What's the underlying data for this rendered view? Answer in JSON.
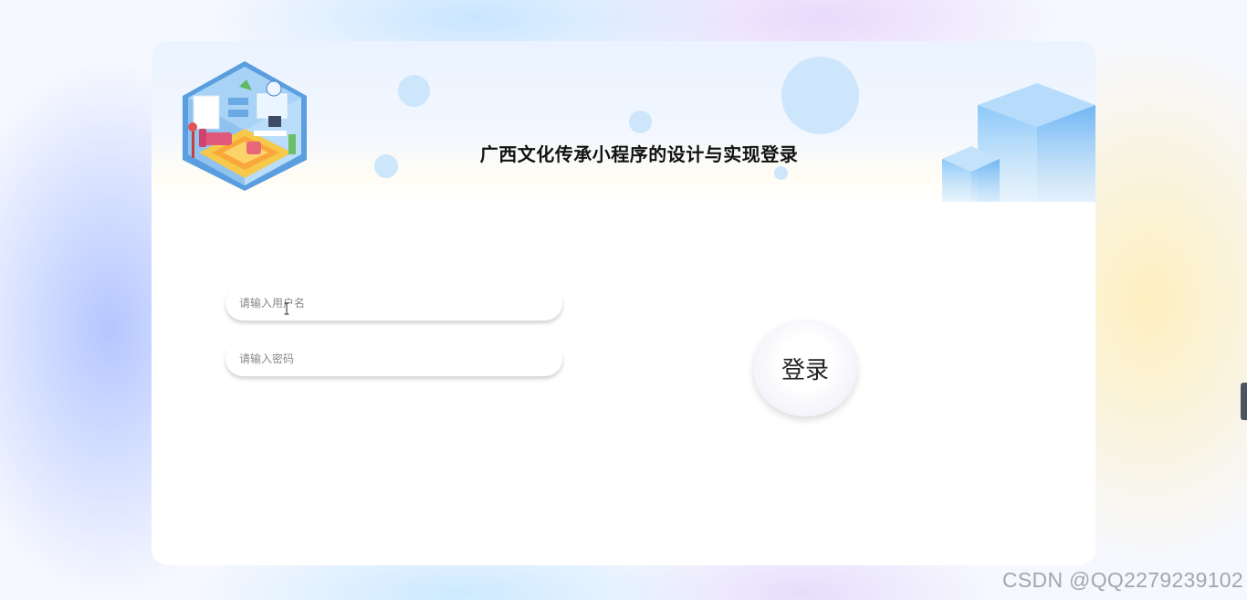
{
  "login": {
    "title": "广西文化传承小程序的设计与实现登录",
    "username_placeholder": "请输入用户名",
    "password_placeholder": "请输入密码",
    "login_button": "登录"
  },
  "watermark": "CSDN @QQ2279239102",
  "colors": {
    "card_background": "#ffffff",
    "banner_bubble": "#cde6fb",
    "cube_blue": "#8cc8f8",
    "title_text": "#111111"
  },
  "icons": {
    "banner_left": "isometric-room-illustration",
    "banner_right": "blue-cubes-decoration",
    "cursor": "text-cursor-icon"
  }
}
